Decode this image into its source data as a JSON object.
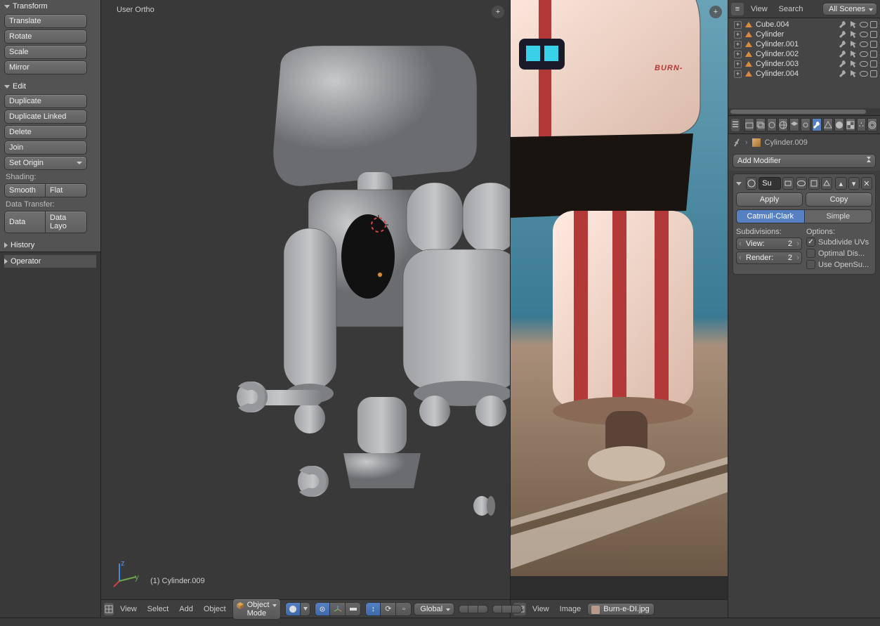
{
  "tool_panel": {
    "transform": {
      "title": "Transform",
      "translate": "Translate",
      "rotate": "Rotate",
      "scale": "Scale",
      "mirror": "Mirror"
    },
    "edit": {
      "title": "Edit",
      "duplicate": "Duplicate",
      "duplicate_linked": "Duplicate Linked",
      "delete": "Delete",
      "join": "Join",
      "set_origin": "Set Origin"
    },
    "shading": {
      "label": "Shading:",
      "smooth": "Smooth",
      "flat": "Flat"
    },
    "data_transfer": {
      "label": "Data Transfer:",
      "data": "Data",
      "layout": "Data Layo"
    },
    "history": {
      "title": "History"
    },
    "operator": {
      "title": "Operator"
    }
  },
  "viewport": {
    "orientation": "User Ortho",
    "active_object": "(1) Cylinder.009",
    "header": {
      "view": "View",
      "select": "Select",
      "add": "Add",
      "object": "Object",
      "mode": "Object Mode",
      "orientation": "Global"
    }
  },
  "image_viewer": {
    "header": {
      "view": "View",
      "image": "Image",
      "file": "Burn-e-DI.jpg"
    },
    "robot_text": "BURN-"
  },
  "outliner": {
    "header": {
      "view": "View",
      "search": "Search",
      "dropdown": "All Scenes"
    },
    "items": [
      {
        "name": "Cube.004"
      },
      {
        "name": "Cylinder"
      },
      {
        "name": "Cylinder.001"
      },
      {
        "name": "Cylinder.002"
      },
      {
        "name": "Cylinder.003"
      },
      {
        "name": "Cylinder.004"
      }
    ]
  },
  "properties": {
    "breadcrumb": {
      "object": "Cylinder.009"
    },
    "add_modifier": "Add Modifier",
    "modifier": {
      "name": "Su",
      "apply": "Apply",
      "copy": "Copy",
      "type_catmull": "Catmull-Clark",
      "type_simple": "Simple",
      "subdivisions_label": "Subdivisions:",
      "view_label": "View:",
      "view_value": "2",
      "render_label": "Render:",
      "render_value": "2",
      "options_label": "Options:",
      "subdivide_uvs": "Subdivide UVs",
      "optimal": "Optimal Dis...",
      "opensub": "Use OpenSu..."
    }
  }
}
